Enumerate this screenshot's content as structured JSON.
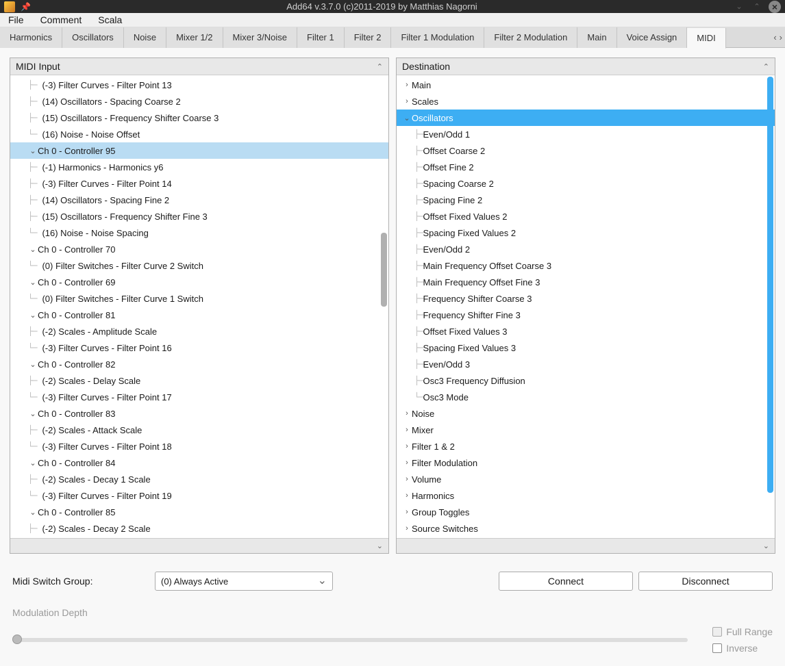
{
  "window": {
    "title": "Add64  v.3.7.0   (c)2011-2019 by Matthias Nagorni"
  },
  "menubar": [
    "File",
    "Comment",
    "Scala"
  ],
  "tabs": [
    "Harmonics",
    "Oscillators",
    "Noise",
    "Mixer 1/2",
    "Mixer 3/Noise",
    "Filter 1",
    "Filter 2",
    "Filter 1 Modulation",
    "Filter 2 Modulation",
    "Main",
    "Voice Assign",
    "MIDI"
  ],
  "active_tab": "MIDI",
  "panels": {
    "midi_input": {
      "title": "MIDI Input",
      "items": [
        {
          "type": "leaf",
          "depth": 2,
          "label": "(-3) Filter Curves - Filter Point 13"
        },
        {
          "type": "leaf",
          "depth": 2,
          "label": "(14) Oscillators - Spacing Coarse 2"
        },
        {
          "type": "leaf",
          "depth": 2,
          "label": "(15) Oscillators - Frequency Shifter Coarse 3"
        },
        {
          "type": "leaf",
          "depth": 2,
          "last": true,
          "label": "(16) Noise - Noise Offset"
        },
        {
          "type": "node",
          "depth": 1,
          "label": "Ch 0 - Controller 95",
          "selected": true
        },
        {
          "type": "leaf",
          "depth": 2,
          "label": "(-1) Harmonics - Harmonics y6"
        },
        {
          "type": "leaf",
          "depth": 2,
          "label": "(-3) Filter Curves - Filter Point 14"
        },
        {
          "type": "leaf",
          "depth": 2,
          "label": "(14) Oscillators - Spacing Fine 2"
        },
        {
          "type": "leaf",
          "depth": 2,
          "label": "(15) Oscillators - Frequency Shifter Fine 3"
        },
        {
          "type": "leaf",
          "depth": 2,
          "last": true,
          "label": "(16) Noise - Noise Spacing"
        },
        {
          "type": "node",
          "depth": 1,
          "label": "Ch 0 - Controller 70"
        },
        {
          "type": "leaf",
          "depth": 2,
          "last": true,
          "label": "(0) Filter Switches - Filter Curve 2  Switch"
        },
        {
          "type": "node",
          "depth": 1,
          "label": "Ch 0 - Controller 69"
        },
        {
          "type": "leaf",
          "depth": 2,
          "last": true,
          "label": "(0) Filter Switches - Filter Curve 1  Switch"
        },
        {
          "type": "node",
          "depth": 1,
          "label": "Ch 0 - Controller 81"
        },
        {
          "type": "leaf",
          "depth": 2,
          "label": "(-2) Scales - Amplitude Scale"
        },
        {
          "type": "leaf",
          "depth": 2,
          "last": true,
          "label": "(-3) Filter Curves - Filter Point 16"
        },
        {
          "type": "node",
          "depth": 1,
          "label": "Ch 0 - Controller 82"
        },
        {
          "type": "leaf",
          "depth": 2,
          "label": "(-2) Scales - Delay Scale"
        },
        {
          "type": "leaf",
          "depth": 2,
          "last": true,
          "label": "(-3) Filter Curves - Filter Point 17"
        },
        {
          "type": "node",
          "depth": 1,
          "label": "Ch 0 - Controller 83"
        },
        {
          "type": "leaf",
          "depth": 2,
          "label": "(-2) Scales - Attack Scale"
        },
        {
          "type": "leaf",
          "depth": 2,
          "last": true,
          "label": "(-3) Filter Curves - Filter Point 18"
        },
        {
          "type": "node",
          "depth": 1,
          "label": "Ch 0 - Controller 84"
        },
        {
          "type": "leaf",
          "depth": 2,
          "label": "(-2) Scales - Decay 1 Scale"
        },
        {
          "type": "leaf",
          "depth": 2,
          "last": true,
          "label": "(-3) Filter Curves - Filter Point 19"
        },
        {
          "type": "node",
          "depth": 1,
          "label": "Ch 0 - Controller 85"
        },
        {
          "type": "leaf",
          "depth": 2,
          "label": "(-2) Scales - Decay 2 Scale"
        }
      ]
    },
    "destination": {
      "title": "Destination",
      "items": [
        {
          "type": "node",
          "depth": 0,
          "label": "Main",
          "collapsed": true
        },
        {
          "type": "node",
          "depth": 0,
          "label": "Scales",
          "collapsed": true
        },
        {
          "type": "node",
          "depth": 0,
          "label": "Oscillators",
          "collapsed": false,
          "selected": true
        },
        {
          "type": "leaf",
          "depth": 1,
          "label": "Even/Odd 1"
        },
        {
          "type": "leaf",
          "depth": 1,
          "label": "Offset Coarse 2"
        },
        {
          "type": "leaf",
          "depth": 1,
          "label": "Offset Fine 2"
        },
        {
          "type": "leaf",
          "depth": 1,
          "label": "Spacing Coarse 2"
        },
        {
          "type": "leaf",
          "depth": 1,
          "label": "Spacing Fine 2"
        },
        {
          "type": "leaf",
          "depth": 1,
          "label": "Offset Fixed Values 2"
        },
        {
          "type": "leaf",
          "depth": 1,
          "label": "Spacing Fixed Values 2"
        },
        {
          "type": "leaf",
          "depth": 1,
          "label": "Even/Odd 2"
        },
        {
          "type": "leaf",
          "depth": 1,
          "label": "Main Frequency Offset Coarse 3"
        },
        {
          "type": "leaf",
          "depth": 1,
          "label": "Main Frequency Offset Fine 3"
        },
        {
          "type": "leaf",
          "depth": 1,
          "label": "Frequency Shifter Coarse 3"
        },
        {
          "type": "leaf",
          "depth": 1,
          "label": "Frequency Shifter Fine 3"
        },
        {
          "type": "leaf",
          "depth": 1,
          "label": "Offset Fixed Values 3"
        },
        {
          "type": "leaf",
          "depth": 1,
          "label": "Spacing Fixed Values 3"
        },
        {
          "type": "leaf",
          "depth": 1,
          "label": "Even/Odd 3"
        },
        {
          "type": "leaf",
          "depth": 1,
          "label": "Osc3 Frequency Diffusion"
        },
        {
          "type": "leaf",
          "depth": 1,
          "last": true,
          "label": "Osc3 Mode"
        },
        {
          "type": "node",
          "depth": 0,
          "label": "Noise",
          "collapsed": true
        },
        {
          "type": "node",
          "depth": 0,
          "label": "Mixer",
          "collapsed": true
        },
        {
          "type": "node",
          "depth": 0,
          "label": "Filter 1 & 2",
          "collapsed": true
        },
        {
          "type": "node",
          "depth": 0,
          "label": "Filter Modulation",
          "collapsed": true
        },
        {
          "type": "node",
          "depth": 0,
          "label": "Volume",
          "collapsed": true
        },
        {
          "type": "node",
          "depth": 0,
          "label": "Harmonics",
          "collapsed": true
        },
        {
          "type": "node",
          "depth": 0,
          "label": "Group Toggles",
          "collapsed": true
        },
        {
          "type": "node",
          "depth": 0,
          "label": "Source Switches",
          "collapsed": true
        }
      ]
    }
  },
  "bottom": {
    "switch_group_label": "Midi Switch Group:",
    "switch_group_value": "(0) Always Active",
    "connect": "Connect",
    "disconnect": "Disconnect",
    "mod_depth_label": "Modulation Depth",
    "full_range": "Full Range",
    "inverse": "Inverse"
  }
}
